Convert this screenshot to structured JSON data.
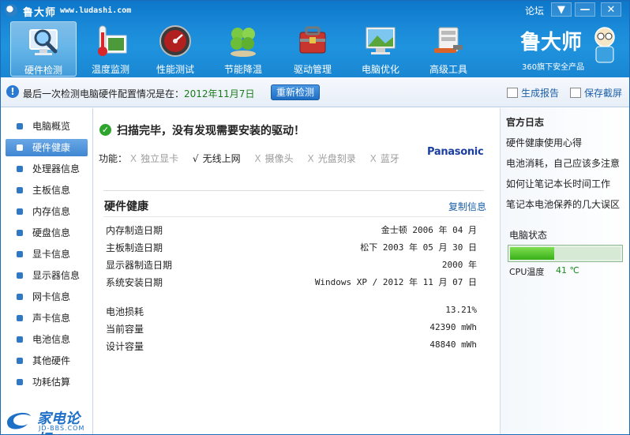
{
  "window": {
    "title": "鲁大师",
    "url": "www.ludashi.com",
    "forum": "论坛",
    "menu_glyph": "▼",
    "min_glyph": "—",
    "close_glyph": "✕"
  },
  "toolbar": {
    "items": [
      {
        "label": "硬件检测",
        "icon": "magnifier-monitor-icon",
        "active": true
      },
      {
        "label": "温度监测",
        "icon": "thermometer-icon",
        "active": false
      },
      {
        "label": "性能测试",
        "icon": "speedometer-icon",
        "active": false
      },
      {
        "label": "节能降温",
        "icon": "clover-icon",
        "active": false
      },
      {
        "label": "驱动管理",
        "icon": "toolbox-icon",
        "active": false
      },
      {
        "label": "电脑优化",
        "icon": "monitor-landscape-icon",
        "active": false
      },
      {
        "label": "高级工具",
        "icon": "tools-icon",
        "active": false
      }
    ],
    "brand_name": "鲁大师",
    "brand_sub": "360旗下安全产品"
  },
  "infobar": {
    "text": "最后一次检测电脑硬件配置情况是在：",
    "date": "2012年11月7日",
    "recheck": "重新检测",
    "report": "生成报告",
    "screenshot": "保存截屏"
  },
  "sidebar": {
    "items": [
      {
        "label": "电脑概览"
      },
      {
        "label": "硬件健康",
        "active": true
      },
      {
        "label": "处理器信息"
      },
      {
        "label": "主板信息"
      },
      {
        "label": "内存信息"
      },
      {
        "label": "硬盘信息"
      },
      {
        "label": "显卡信息"
      },
      {
        "label": "显示器信息"
      },
      {
        "label": "网卡信息"
      },
      {
        "label": "声卡信息"
      },
      {
        "label": "电池信息"
      },
      {
        "label": "其他硬件"
      },
      {
        "label": "功耗估算"
      }
    ],
    "watermark": "家电论坛",
    "watermark_sub": "JD-BBS.COM"
  },
  "main": {
    "scan_title": "扫描完毕，没有发现需要安装的驱动！",
    "features_label": "功能：",
    "features": [
      {
        "mark": "X",
        "label": "独立显卡",
        "ok": false
      },
      {
        "mark": "√",
        "label": "无线上网",
        "ok": true
      },
      {
        "mark": "X",
        "label": "摄像头",
        "ok": false
      },
      {
        "mark": "X",
        "label": "光盘刻录",
        "ok": false
      },
      {
        "mark": "X",
        "label": "蓝牙",
        "ok": false
      }
    ],
    "brand": "Panasonic",
    "section_title": "硬件健康",
    "copy": "复制信息",
    "rows": [
      {
        "key": "内存制造日期",
        "value": "金士顿 2006 年 04 月"
      },
      {
        "key": "主板制造日期",
        "value": "松下 2003 年 05 月 30 日"
      },
      {
        "key": "显示器制造日期",
        "value": "2000 年"
      },
      {
        "key": "系统安装日期",
        "value": "Windows XP / 2012 年 11 月 07 日"
      }
    ],
    "battery_rows": [
      {
        "key": "电池损耗",
        "value": "13.21%"
      },
      {
        "key": "当前容量",
        "value": "42390 mWh"
      },
      {
        "key": "设计容量",
        "value": "48840 mWh"
      }
    ]
  },
  "right_panel": {
    "title": "官方日志",
    "items": [
      "硬件健康使用心得",
      "电池消耗，自己应该多注意",
      "如何让笔记本长时间工作",
      "笔记本电池保养的几大误区"
    ],
    "status_title": "电脑状态",
    "status_level": 0.4,
    "cpu_label": "CPU温度",
    "cpu_value": "41 ℃"
  },
  "colors": {
    "header_blue": "#1a8ad8",
    "link_blue": "#1c5fa8",
    "ok_green": "#2da52d"
  }
}
